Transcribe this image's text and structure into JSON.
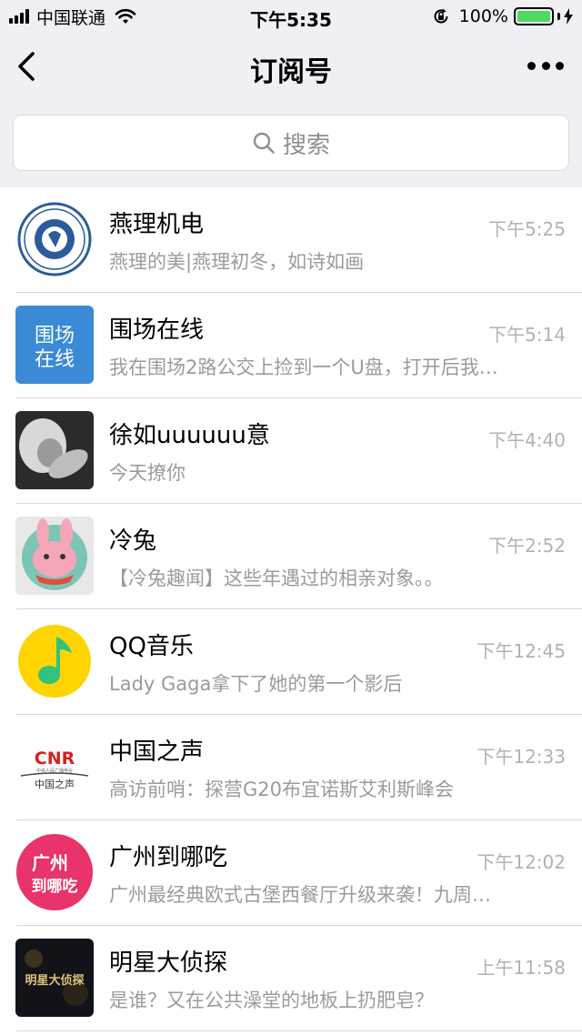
{
  "status_bar": {
    "carrier": "中国联通",
    "time": "下午5:35",
    "battery": "100%"
  },
  "nav": {
    "title": "订阅号"
  },
  "search": {
    "placeholder": "搜索"
  },
  "accounts": [
    {
      "name": "燕理机电",
      "time": "下午5:25",
      "preview": "燕理的美|燕理初冬，如诗如画",
      "avatar_icon": "gear-emblem-logo"
    },
    {
      "name": "围场在线",
      "time": "下午5:14",
      "preview": "我在围场2路公交上捡到一个U盘，打开后我…",
      "avatar_icon": "weichang-logo",
      "avatar_text": [
        "围场",
        "在线"
      ]
    },
    {
      "name": "徐如uuuuuu意",
      "time": "下午4:40",
      "preview": "今天撩你",
      "avatar_icon": "photo-avatar"
    },
    {
      "name": "冷兔",
      "time": "下午2:52",
      "preview": "【冷兔趣闻】这些年遇过的相亲对象。。",
      "avatar_icon": "rabbit-avatar"
    },
    {
      "name": "QQ音乐",
      "time": "下午12:45",
      "preview": "Lady Gaga拿下了她的第一个影后",
      "avatar_icon": "music-note-logo"
    },
    {
      "name": "中国之声",
      "time": "下午12:33",
      "preview": "高访前哨：探营G20布宜诺斯艾利斯峰会",
      "avatar_icon": "cnr-logo",
      "avatar_text": [
        "CNR",
        "中央人民广播电台",
        "中国之声"
      ]
    },
    {
      "name": "广州到哪吃",
      "time": "下午12:02",
      "preview": "广州最经典欧式古堡西餐厅升级来袭！九周…",
      "avatar_icon": "guangzhou-logo",
      "avatar_text": [
        "广州",
        "到哪吃"
      ]
    },
    {
      "name": "明星大侦探",
      "time": "上午11:58",
      "preview": "是谁？又在公共澡堂的地板上扔肥皂？",
      "avatar_icon": "show-poster-avatar",
      "avatar_text": [
        "明星大侦探"
      ]
    }
  ],
  "colors": {
    "header_bg": "#efeff4",
    "battery_green": "#4cd964",
    "secondary_text": "#9b9b9b"
  }
}
